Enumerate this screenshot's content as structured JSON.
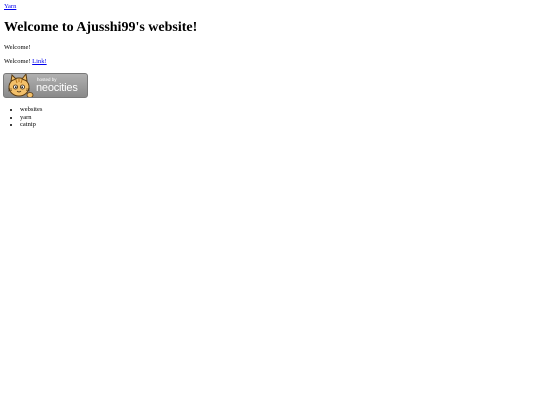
{
  "nav": {
    "top_link": "Yarn"
  },
  "main": {
    "heading": "Welcome to Ajusshi99's website!",
    "paragraph1": "Welcome!",
    "paragraph2_prefix": "Welcome! ",
    "paragraph2_link": "Link!"
  },
  "badge": {
    "small_text": "hosted by",
    "big_text": "neocities",
    "icon": "neocities-cat-icon"
  },
  "list": {
    "items": [
      "websites",
      "yarn",
      "catnip"
    ]
  }
}
